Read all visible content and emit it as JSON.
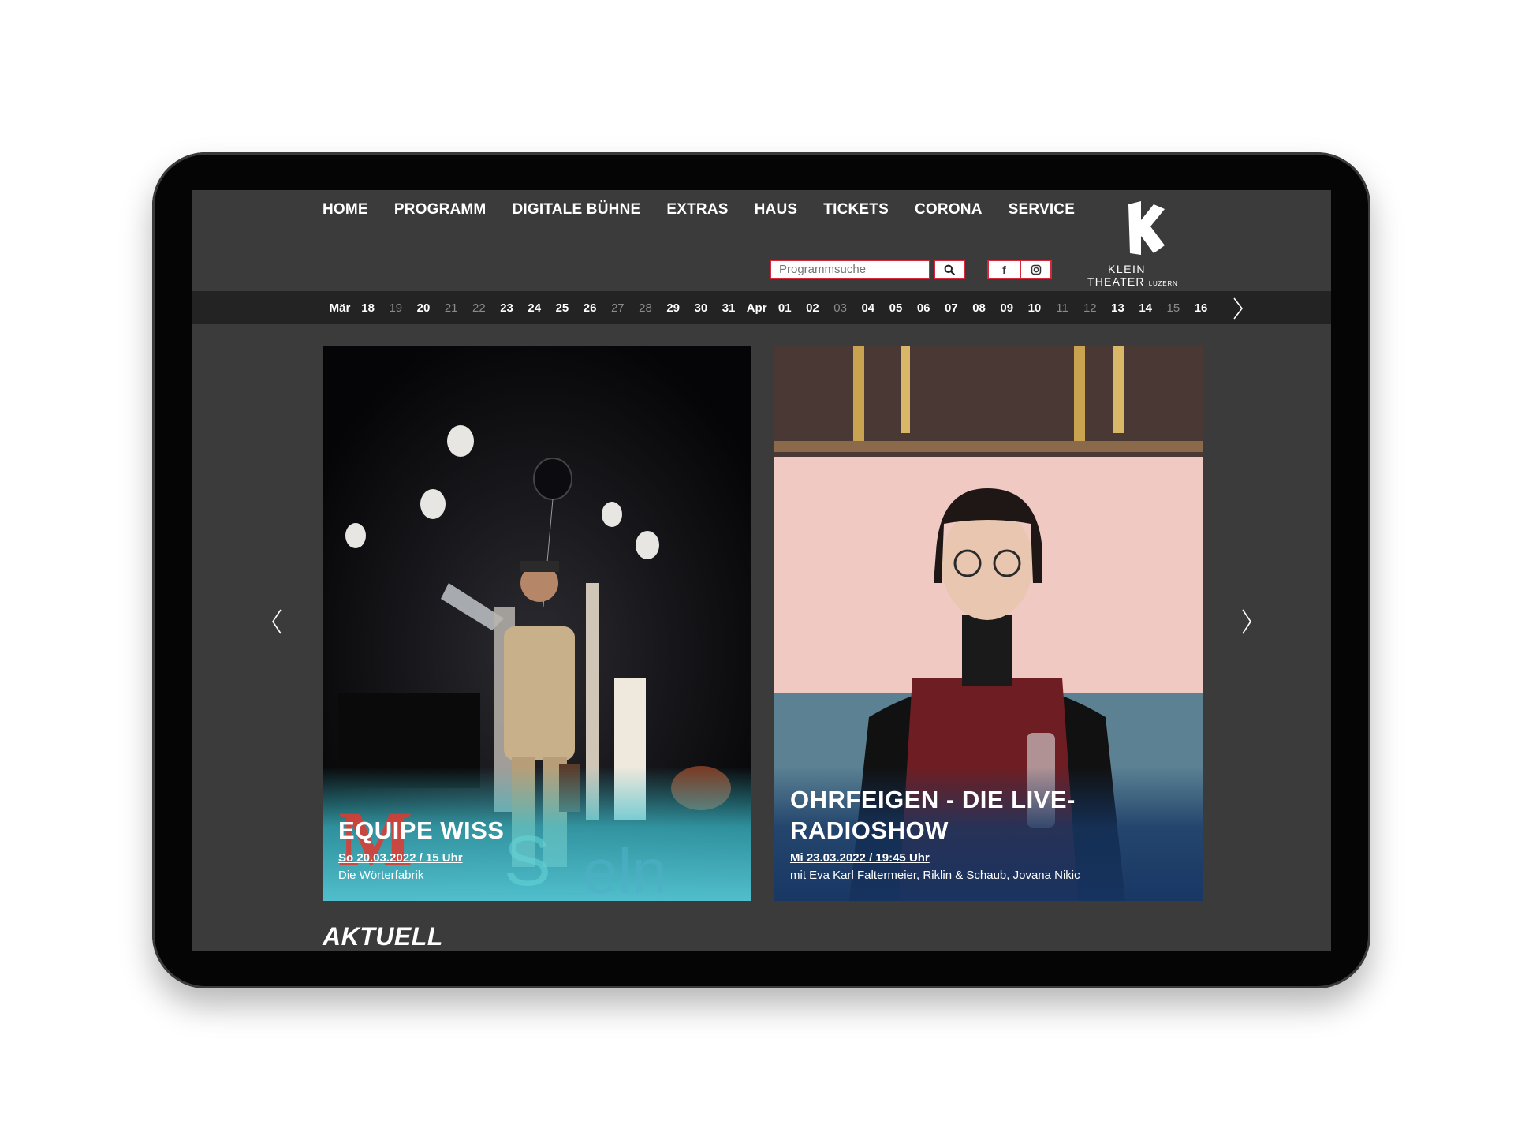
{
  "nav": {
    "items": [
      "HOME",
      "PROGRAMM",
      "DIGITALE BÜHNE",
      "EXTRAS",
      "HAUS",
      "TICKETS",
      "CORONA",
      "SERVICE"
    ]
  },
  "search": {
    "placeholder": "Programmsuche",
    "icon": "search-icon"
  },
  "social": {
    "facebook": "f",
    "instagram_icon": "instagram-icon"
  },
  "logo": {
    "line1": "KLEIN",
    "line2": "THEATER",
    "line3": "LUZERN"
  },
  "dates": [
    {
      "label": "Mär",
      "type": "month"
    },
    {
      "label": "18",
      "type": "active"
    },
    {
      "label": "19",
      "type": "dim"
    },
    {
      "label": "20",
      "type": "active"
    },
    {
      "label": "21",
      "type": "dim"
    },
    {
      "label": "22",
      "type": "dim"
    },
    {
      "label": "23",
      "type": "active"
    },
    {
      "label": "24",
      "type": "active"
    },
    {
      "label": "25",
      "type": "active"
    },
    {
      "label": "26",
      "type": "active"
    },
    {
      "label": "27",
      "type": "dim"
    },
    {
      "label": "28",
      "type": "dim"
    },
    {
      "label": "29",
      "type": "active"
    },
    {
      "label": "30",
      "type": "active"
    },
    {
      "label": "31",
      "type": "active"
    },
    {
      "label": "Apr",
      "type": "month"
    },
    {
      "label": "01",
      "type": "active"
    },
    {
      "label": "02",
      "type": "active"
    },
    {
      "label": "03",
      "type": "dim"
    },
    {
      "label": "04",
      "type": "active"
    },
    {
      "label": "05",
      "type": "active"
    },
    {
      "label": "06",
      "type": "active"
    },
    {
      "label": "07",
      "type": "active"
    },
    {
      "label": "08",
      "type": "active"
    },
    {
      "label": "09",
      "type": "active"
    },
    {
      "label": "10",
      "type": "active"
    },
    {
      "label": "11",
      "type": "dim"
    },
    {
      "label": "12",
      "type": "dim"
    },
    {
      "label": "13",
      "type": "active"
    },
    {
      "label": "14",
      "type": "active"
    },
    {
      "label": "15",
      "type": "dim"
    },
    {
      "label": "16",
      "type": "active"
    }
  ],
  "cards": [
    {
      "title": "EQUIPE WISS",
      "date": "So 20.03.2022 / 15 Uhr",
      "subtitle": "Die Wörterfabrik"
    },
    {
      "title_line1": "OHRFEIGEN - DIE LIVE-",
      "title_line2": "RADIOSHOW",
      "date": "Mi 23.03.2022 / 19:45 Uhr",
      "subtitle": "mit Eva Karl Faltermeier, Riklin & Schaub, Jovana Nikic"
    }
  ],
  "section": {
    "aktuell": "AKTUELL"
  },
  "colors": {
    "accent": "#d5283a",
    "screen_bg": "#3b3b3b",
    "date_strip_bg": "#232323"
  }
}
